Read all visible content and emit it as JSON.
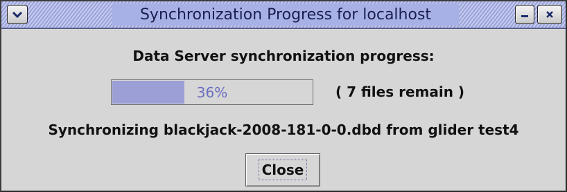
{
  "window": {
    "title": "Synchronization Progress for localhost",
    "controls": {
      "menu_icon": "chevron-down-icon",
      "minimize_icon": "minimize-icon",
      "close_icon": "close-icon"
    }
  },
  "content": {
    "heading": "Data Server synchronization progress:",
    "progress": {
      "value": 0.36,
      "label": "36%"
    },
    "remaining": "( 7 files remain )",
    "status": "Synchronizing blackjack-2008-181-0-0.dbd from glider test4"
  },
  "buttons": {
    "close_label": "Close"
  },
  "colors": {
    "title_bar": "#a9b1e3",
    "progress_fill": "#9b9fd6",
    "progress_text": "#6a6ec0",
    "window_bg": "#d6d6d6"
  }
}
